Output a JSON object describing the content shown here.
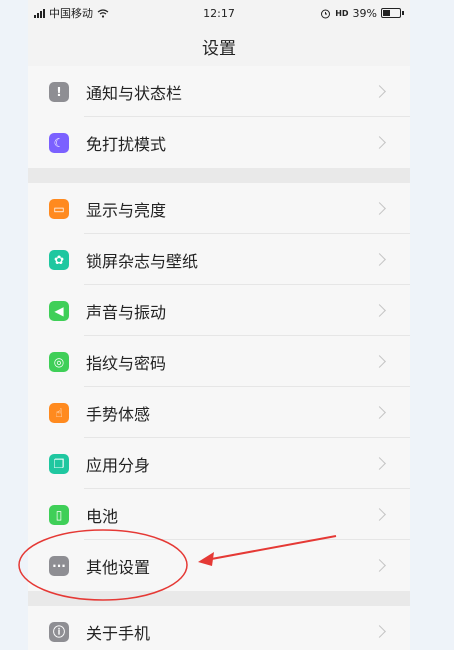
{
  "status_bar": {
    "carrier": "中国移动",
    "time": "12:17",
    "hd": "HD",
    "battery": "39%"
  },
  "title": "设置",
  "groups": [
    {
      "items": [
        {
          "label": "通知与状态栏",
          "icon": "notification-icon",
          "color": "#8e8e93",
          "glyph": "!"
        },
        {
          "label": "免打扰模式",
          "icon": "moon-icon",
          "color": "#7b61ff",
          "glyph": "☾"
        }
      ]
    },
    {
      "items": [
        {
          "label": "显示与亮度",
          "icon": "display-icon",
          "color": "#ff8a1f",
          "glyph": "▭"
        },
        {
          "label": "锁屏杂志与壁纸",
          "icon": "flower-icon",
          "color": "#1fc7a0",
          "glyph": "✿"
        },
        {
          "label": "声音与振动",
          "icon": "speaker-icon",
          "color": "#3fcf58",
          "glyph": "◀"
        },
        {
          "label": "指纹与密码",
          "icon": "fingerprint-icon",
          "color": "#3fcf58",
          "glyph": "◎"
        },
        {
          "label": "手势体感",
          "icon": "hand-icon",
          "color": "#ff8a1f",
          "glyph": "☝"
        },
        {
          "label": "应用分身",
          "icon": "clone-icon",
          "color": "#1fc7a0",
          "glyph": "❐"
        },
        {
          "label": "电池",
          "icon": "battery-icon",
          "color": "#3fcf58",
          "glyph": "▯"
        },
        {
          "label": "其他设置",
          "icon": "more-icon",
          "color": "#8e8e93",
          "glyph": "···"
        }
      ]
    },
    {
      "items": [
        {
          "label": "关于手机",
          "icon": "info-icon",
          "color": "#8e8e93",
          "glyph": "ⓘ"
        }
      ]
    }
  ],
  "annotation_color": "#e53935"
}
